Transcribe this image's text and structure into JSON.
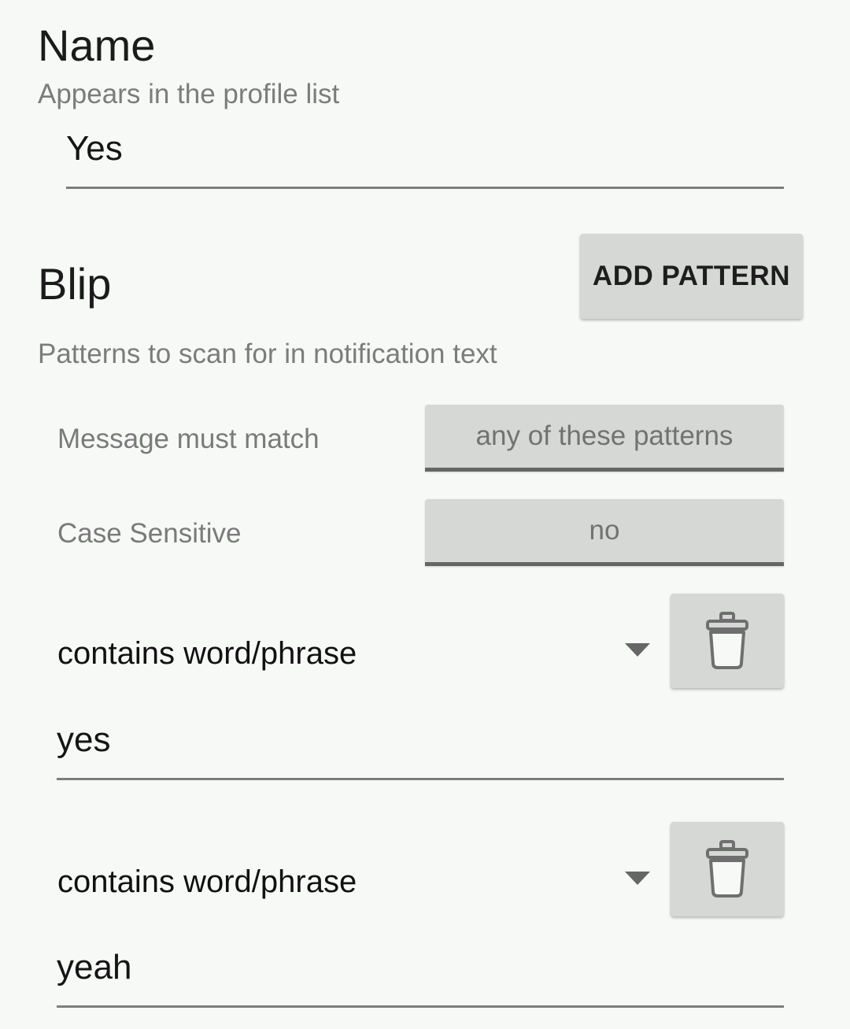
{
  "name_section": {
    "title": "Name",
    "subtitle": "Appears in the profile list",
    "value": "Yes"
  },
  "blip_section": {
    "title": "Blip",
    "add_button_label": "ADD PATTERN",
    "subtitle": "Patterns to scan for in notification text",
    "options": [
      {
        "label": "Message must match",
        "value": "any of these patterns"
      },
      {
        "label": "Case Sensitive",
        "value": "no"
      }
    ],
    "patterns": [
      {
        "type": "contains word/phrase",
        "value": "yes"
      },
      {
        "type": "contains word/phrase",
        "value": "yeah"
      }
    ]
  },
  "icons": {
    "dropdown": "triangle-down-icon",
    "delete": "trash-icon"
  }
}
